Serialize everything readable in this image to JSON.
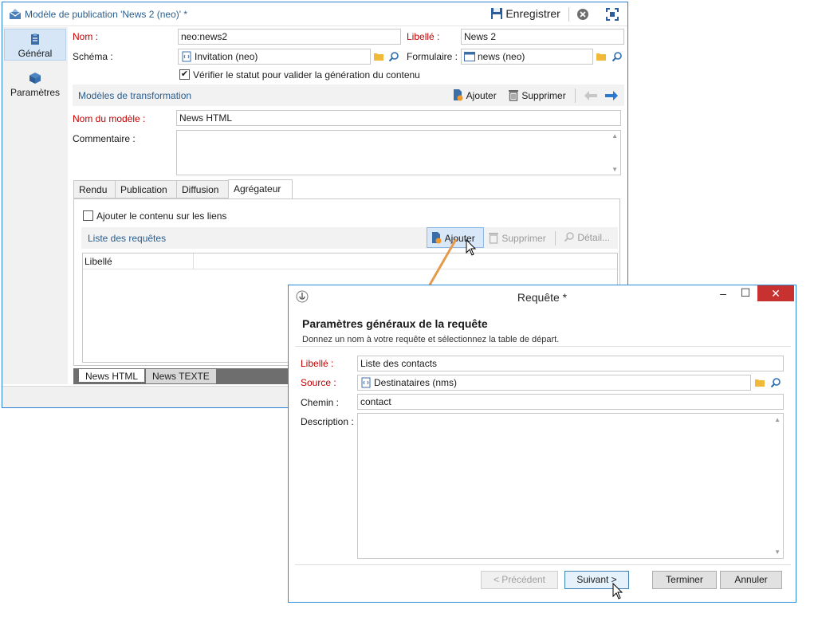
{
  "main_window": {
    "title": "Modèle de publication 'News 2 (neo)' *",
    "toolbar": {
      "save_label": "Enregistrer"
    },
    "sidebar": {
      "items": [
        {
          "label": "Général"
        },
        {
          "label": "Paramètres"
        }
      ]
    },
    "form": {
      "name_label": "Nom :",
      "name_value": "neo:news2",
      "libelle_label": "Libellé :",
      "libelle_value": "News 2",
      "schema_label": "Schéma :",
      "schema_value": "Invitation (neo)",
      "formulaire_label": "Formulaire :",
      "formulaire_value": "news (neo)",
      "verify_label": "Vérifier le statut pour valider la génération du contenu",
      "verify_checked": true
    },
    "transform_section": {
      "title": "Modèles de transformation",
      "add_label": "Ajouter",
      "delete_label": "Supprimer",
      "model_name_label": "Nom du modèle :",
      "model_name_value": "News HTML",
      "comment_label": "Commentaire :"
    },
    "tabs": [
      {
        "label": "Rendu"
      },
      {
        "label": "Publication"
      },
      {
        "label": "Diffusion"
      },
      {
        "label": "Agrégateur",
        "active": true
      }
    ],
    "aggregator": {
      "add_content_label": "Ajouter le contenu sur les liens",
      "list_title": "Liste des requêtes",
      "add_label": "Ajouter",
      "delete_label": "Supprimer",
      "detail_label": "Détail...",
      "column_header": "Libellé"
    },
    "bottom_tabs": [
      {
        "label": "News HTML",
        "active": true
      },
      {
        "label": "News TEXTE"
      }
    ]
  },
  "dialog": {
    "title": "Requête *",
    "heading": "Paramètres généraux de la requête",
    "subheading": "Donnez un nom à votre requête et sélectionnez la table de départ.",
    "libelle_label": "Libellé :",
    "libelle_value": "Liste des contacts",
    "source_label": "Source :",
    "source_value": "Destinataires (nms)",
    "chemin_label": "Chemin :",
    "chemin_value": "contact",
    "description_label": "Description :",
    "buttons": {
      "prev": "< Précédent",
      "next": "Suivant >",
      "finish": "Terminer",
      "cancel": "Annuler"
    }
  },
  "colors": {
    "accent": "#2b7fd4",
    "required": "#c00000",
    "close": "#c7312f",
    "arrow": "#e59a4c"
  }
}
